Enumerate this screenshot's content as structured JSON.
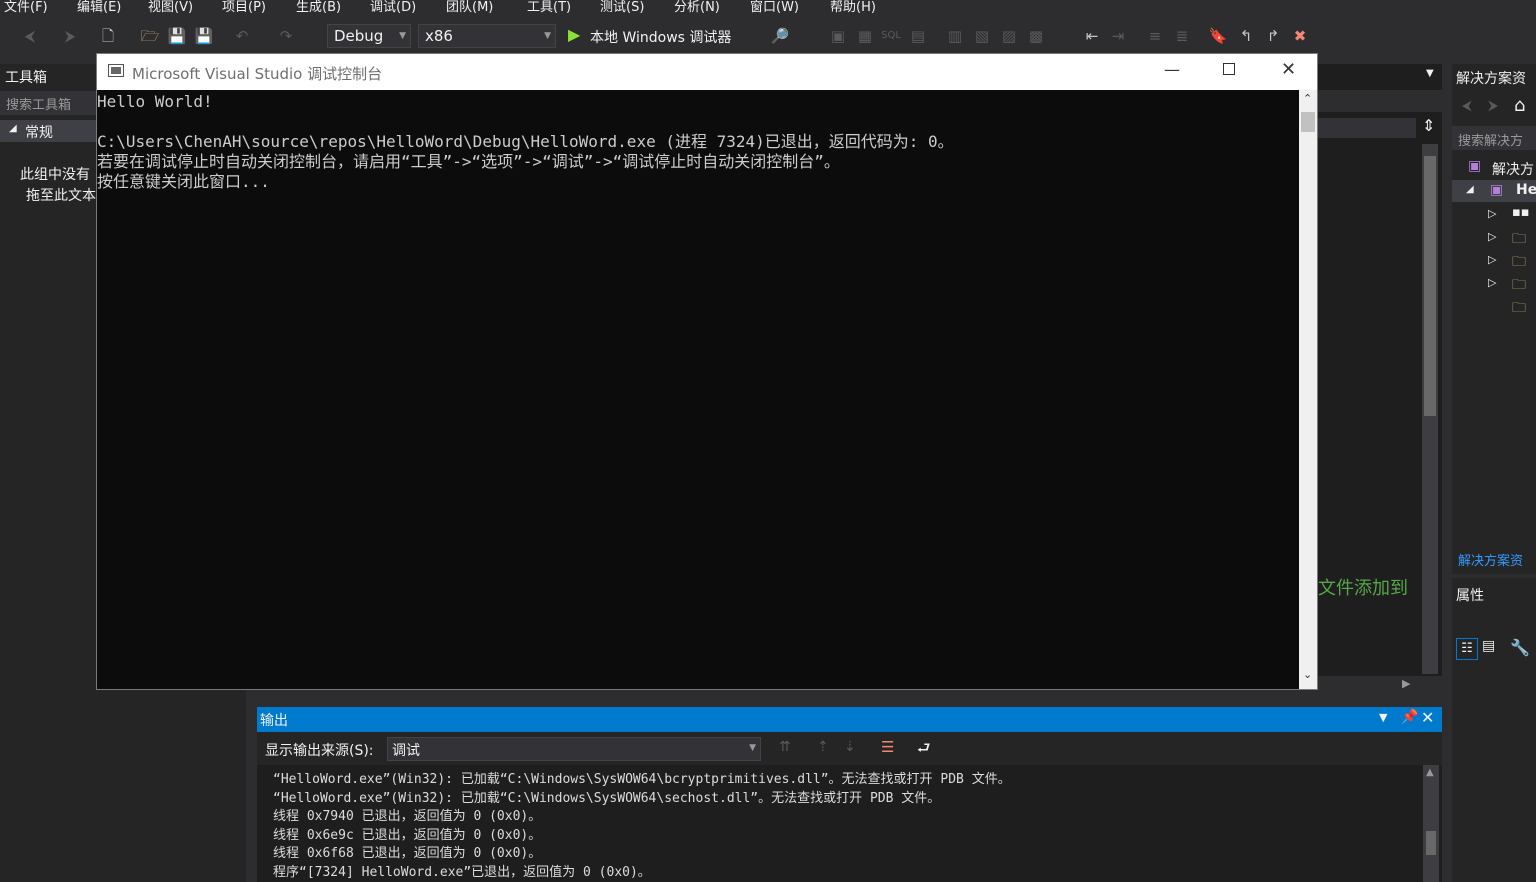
{
  "menu": [
    "文件(F)",
    "编辑(E)",
    "视图(V)",
    "项目(P)",
    "生成(B)",
    "调试(D)",
    "团队(M)",
    "工具(T)",
    "测试(S)",
    "分析(N)",
    "窗口(W)",
    "帮助(H)"
  ],
  "toolbar": {
    "config": "Debug",
    "platform": "x86",
    "start_label": "本地 Windows 调试器"
  },
  "toolbox": {
    "title": "工具箱",
    "search_placeholder": "搜索工具箱",
    "group": "常规",
    "empty_line1": "此组中没有",
    "empty_line2": "拖至此文本"
  },
  "console": {
    "title": "Microsoft Visual Studio 调试控制台",
    "lines": [
      "Hello World!",
      "",
      "C:\\Users\\ChenAH\\source\\repos\\HelloWord\\Debug\\HelloWord.exe (进程 7324)已退出，返回代码为: 0。",
      "若要在调试停止时自动关闭控制台，请启用“工具”->“选项”->“调试”->“调试停止时自动关闭控制台”。",
      "按任意键关闭此窗口..."
    ]
  },
  "solution_explorer": {
    "title": "解决方案资",
    "search": "搜索解决方",
    "root": "解决方",
    "project": "He",
    "footer_link": "解决方案资"
  },
  "editor": {
    "hint_fragment": "文件添加到"
  },
  "properties": {
    "title": "属性"
  },
  "output": {
    "title": "输出",
    "source_label": "显示输出来源(S):",
    "source_value": "调试",
    "lines": [
      "“HelloWord.exe”(Win32): 已加载“C:\\Windows\\SysWOW64\\bcryptprimitives.dll”。无法查找或打开 PDB 文件。",
      "“HelloWord.exe”(Win32): 已加载“C:\\Windows\\SysWOW64\\sechost.dll”。无法查找或打开 PDB 文件。",
      "线程 0x7940 已退出，返回值为 0 (0x0)。",
      "线程 0x6e9c 已退出，返回值为 0 (0x0)。",
      "线程 0x6f68 已退出，返回值为 0 (0x0)。",
      "程序“[7324] HelloWord.exe”已退出，返回值为 0 (0x0)。"
    ]
  },
  "colors": {
    "accent": "#007acc",
    "play": "#8ae234",
    "ide_bg": "#2d2d30"
  }
}
